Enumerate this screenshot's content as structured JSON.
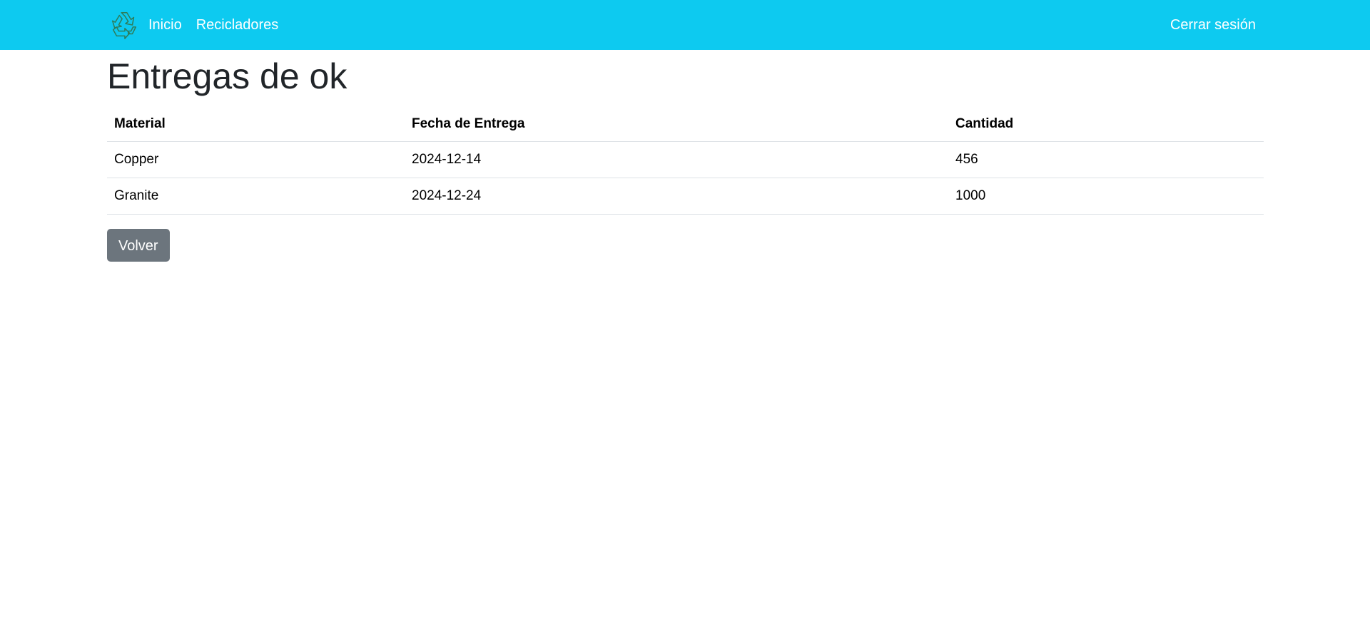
{
  "navbar": {
    "logo_icon": "recycle-icon",
    "links": [
      {
        "label": "Inicio"
      },
      {
        "label": "Recicladores"
      }
    ],
    "logout_label": "Cerrar sesión",
    "background_color": "#0dcaf0"
  },
  "page": {
    "title": "Entregas de ok"
  },
  "table": {
    "headers": [
      "Material",
      "Fecha de Entrega",
      "Cantidad"
    ],
    "rows": [
      {
        "material": "Copper",
        "fecha": "2024-12-14",
        "cantidad": "456"
      },
      {
        "material": "Granite",
        "fecha": "2024-12-24",
        "cantidad": "1000"
      }
    ]
  },
  "actions": {
    "back_label": "Volver",
    "back_color": "#6c757d"
  }
}
